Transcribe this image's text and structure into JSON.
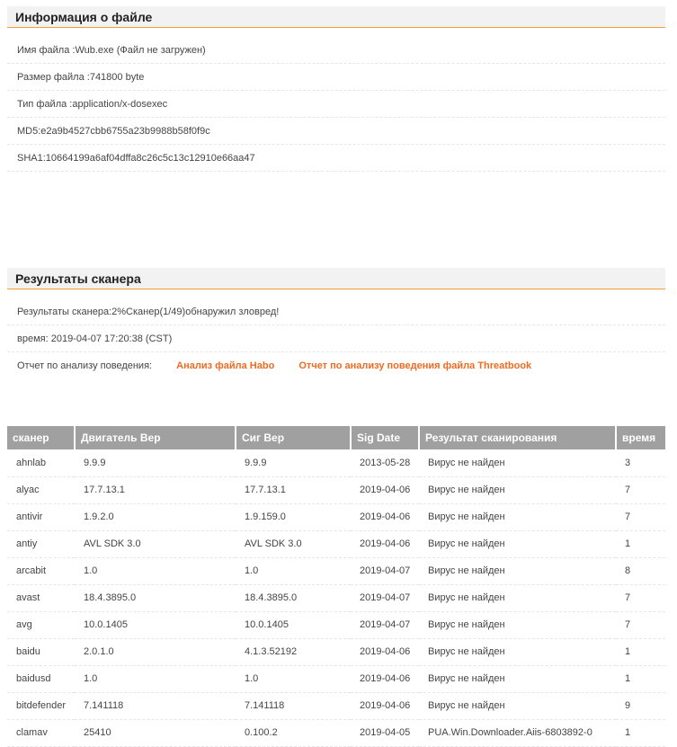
{
  "file_info": {
    "title": "Информация о файле",
    "name": "Имя файла :Wub.exe (Файл не загружен)",
    "size": "Размер файла :741800 byte",
    "type": "Тип файла :application/x-dosexec",
    "md5": "MD5:e2a9b4527cbb6755a23b9988b58f0f9c",
    "sha1": "SHA1:10664199a6af04dffa8c26c5c13c12910e66aa47"
  },
  "scanner_results": {
    "title": "Результаты сканера",
    "summary": "Результаты сканера:2%Сканер(1/49)обнаружил зловред!",
    "time": "время: 2019-04-07 17:20:38 (CST)",
    "report_label": "Отчет по анализу поведения:",
    "habo_link": "Анализ файла Habo",
    "threatbook_link": "Отчет по анализу поведения файла Threatbook",
    "link_color": "#f06a20"
  },
  "table": {
    "headers": [
      "сканер",
      "Двигатель Вер",
      "Сиг Вер",
      "Sig Date",
      "Результат сканирования",
      "время"
    ],
    "rows": [
      {
        "scanner": "ahnlab",
        "engine": "9.9.9",
        "sig": "9.9.9",
        "date": "2013-05-28",
        "result": "Вирус не найден",
        "time": "3",
        "status": "ok"
      },
      {
        "scanner": "alyac",
        "engine": "17.7.13.1",
        "sig": "17.7.13.1",
        "date": "2019-04-06",
        "result": "Вирус не найден",
        "time": "7",
        "status": "ok"
      },
      {
        "scanner": "antivir",
        "engine": "1.9.2.0",
        "sig": "1.9.159.0",
        "date": "2019-04-06",
        "result": "Вирус не найден",
        "time": "7",
        "status": "ok"
      },
      {
        "scanner": "antiy",
        "engine": "AVL SDK 3.0",
        "sig": "AVL SDK 3.0",
        "date": "2019-04-06",
        "result": "Вирус не найден",
        "time": "1",
        "status": "ok"
      },
      {
        "scanner": "arcabit",
        "engine": "1.0",
        "sig": "1.0",
        "date": "2019-04-07",
        "result": "Вирус не найден",
        "time": "8",
        "status": "ok"
      },
      {
        "scanner": "avast",
        "engine": "18.4.3895.0",
        "sig": "18.4.3895.0",
        "date": "2019-04-07",
        "result": "Вирус не найден",
        "time": "7",
        "status": "ok"
      },
      {
        "scanner": "avg",
        "engine": "10.0.1405",
        "sig": "10.0.1405",
        "date": "2019-04-07",
        "result": "Вирус не найден",
        "time": "7",
        "status": "ok"
      },
      {
        "scanner": "baidu",
        "engine": "2.0.1.0",
        "sig": "4.1.3.52192",
        "date": "2019-04-06",
        "result": "Вирус не найден",
        "time": "1",
        "status": "ok"
      },
      {
        "scanner": "baidusd",
        "engine": "1.0",
        "sig": "1.0",
        "date": "2019-04-06",
        "result": "Вирус не найден",
        "time": "1",
        "status": "ok"
      },
      {
        "scanner": "bitdefender",
        "engine": "7.141118",
        "sig": "7.141118",
        "date": "2019-04-06",
        "result": "Вирус не найден",
        "time": "9",
        "status": "ok"
      },
      {
        "scanner": "clamav",
        "engine": "25410",
        "sig": "0.100.2",
        "date": "2019-04-05",
        "result": "PUA.Win.Downloader.Aiis-6803892-0",
        "time": "1",
        "status": "bad"
      }
    ]
  },
  "colors": {
    "accent": "#f0a030",
    "header_bg": "#a0a0a0",
    "ok": "#2a8a2a",
    "bad": "#cc2222"
  }
}
